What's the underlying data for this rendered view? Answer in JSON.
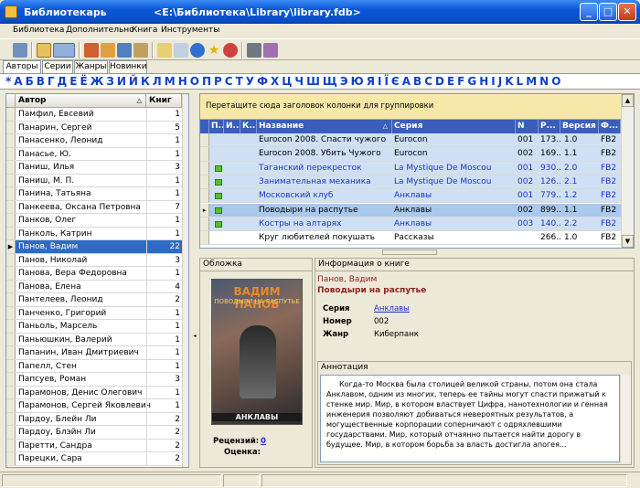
{
  "window": {
    "app_title": "Библиотекарь",
    "path": "<E:\\Библиотека\\Library\\library.fdb>"
  },
  "menu": [
    "Библиотека",
    "Дополнительно",
    "Книга",
    "Инструменты"
  ],
  "tabs": [
    "Авторы",
    "Серии",
    "Жанры",
    "Новинки"
  ],
  "alphabet": [
    "*",
    "А",
    "Б",
    "В",
    "Г",
    "Д",
    "Е",
    "Ё",
    "Ж",
    "З",
    "И",
    "Й",
    "К",
    "Л",
    "М",
    "Н",
    "О",
    "П",
    "Р",
    "С",
    "Т",
    "У",
    "Ф",
    "Х",
    "Ц",
    "Ч",
    "Ш",
    "Щ",
    "Э",
    "Ю",
    "Я",
    "І",
    "Ї",
    "Є",
    "A",
    "B",
    "C",
    "D",
    "E",
    "F",
    "G",
    "H",
    "I",
    "J",
    "K",
    "L",
    "M",
    "N",
    "O"
  ],
  "authors": {
    "headers": {
      "author": "Автор",
      "count": "Книг"
    },
    "rows": [
      {
        "name": "Памфил, Евсевий",
        "count": "1"
      },
      {
        "name": "Панарин, Сергей",
        "count": "5"
      },
      {
        "name": "Панасенко, Леонид",
        "count": "1"
      },
      {
        "name": "Панасье, Ю.",
        "count": "1"
      },
      {
        "name": "Паниш, Илья",
        "count": "3"
      },
      {
        "name": "Паниш, М. П.",
        "count": "1"
      },
      {
        "name": "Панина, Татьяна",
        "count": "1"
      },
      {
        "name": "Панкеева, Оксана Петровна",
        "count": "7"
      },
      {
        "name": "Панков, Олег",
        "count": "1"
      },
      {
        "name": "Панколь, Катрин",
        "count": "1"
      },
      {
        "name": "Панов, Вадим",
        "count": "22"
      },
      {
        "name": "Панов, Николай",
        "count": "3"
      },
      {
        "name": "Панова, Вера Федоровна",
        "count": "1"
      },
      {
        "name": "Панова, Елена",
        "count": "4"
      },
      {
        "name": "Пантелеев, Леонид",
        "count": "2"
      },
      {
        "name": "Панченко, Григорий",
        "count": "1"
      },
      {
        "name": "Паньоль, Марсель",
        "count": "1"
      },
      {
        "name": "Паньюшкин, Валерий",
        "count": "1"
      },
      {
        "name": "Папанин, Иван Дмитриевич",
        "count": "1"
      },
      {
        "name": "Папелл, Стен",
        "count": "1"
      },
      {
        "name": "Папсуев, Роман",
        "count": "3"
      },
      {
        "name": "Парамонов, Денис Олегович",
        "count": "1"
      },
      {
        "name": "Парамонов, Сергей Яковлевич",
        "count": "1"
      },
      {
        "name": "Пардоу, Блейн Ли",
        "count": "2"
      },
      {
        "name": "Пардоу, Блэйн Ли",
        "count": "2"
      },
      {
        "name": "Паретти, Сандра",
        "count": "2"
      },
      {
        "name": "Парецки, Сара",
        "count": "2"
      }
    ]
  },
  "books": {
    "group_hint": "Перетащите сюда заголовок колонки для группировки",
    "headers": {
      "p": "П..",
      "i": "И..",
      "k": "К..",
      "title": "Название",
      "series": "Серия",
      "n": "N",
      "r": "Р...",
      "version": "Версия",
      "format": "Ф..."
    },
    "rows": [
      {
        "title": "Eurocon 2008. Спасти чужого",
        "series": "Eurocon",
        "n": "001",
        "r": "173...",
        "version": "1.0",
        "format": "FB2",
        "blue": false,
        "icon": false
      },
      {
        "title": "Eurocon 2008. Убить Чужого",
        "series": "Eurocon",
        "n": "002",
        "r": "169...",
        "version": "1.1",
        "format": "FB2",
        "blue": false,
        "icon": false
      },
      {
        "title": "Таганский перекресток",
        "series": "La Mystique De Moscou",
        "n": "001",
        "r": "930...",
        "version": "2.0",
        "format": "FB2",
        "blue": true,
        "icon": true
      },
      {
        "title": "Занимательная механика",
        "series": "La Mystique De Moscou",
        "n": "002",
        "r": "126...",
        "version": "2.1",
        "format": "FB2",
        "blue": true,
        "icon": true
      },
      {
        "title": "Московский клуб",
        "series": "Анклавы",
        "n": "001",
        "r": "779...",
        "version": "1.2",
        "format": "FB2",
        "blue": true,
        "icon": true
      },
      {
        "title": "Поводыри на распутье",
        "series": "Анклавы",
        "n": "002",
        "r": "899...",
        "version": "1.1",
        "format": "FB2",
        "blue": false,
        "icon": true
      },
      {
        "title": "Костры на алтарях",
        "series": "Анклавы",
        "n": "003",
        "r": "140...",
        "version": "2.2",
        "format": "FB2",
        "blue": true,
        "icon": true
      },
      {
        "title": "Круг любителей покушать",
        "series": "Рассказы",
        "n": "",
        "r": "266...",
        "version": "1.0",
        "format": "FB2",
        "blue": false,
        "icon": false
      }
    ]
  },
  "cover_panel": {
    "title": "Обложка",
    "cover_author": "ВАДИМ ПАНОВ",
    "cover_title": "ПОВОДЫРИ НА РАСПУТЬЕ",
    "cover_series": "АНКЛАВЫ",
    "reviews_label": "Рецензий:",
    "reviews_value": "0",
    "rating_label": "Оценка:"
  },
  "info_panel": {
    "title": "Информация о книге",
    "author": "Панов, Вадим",
    "book_title": "Поводыри на распутье",
    "series_label": "Серия",
    "series_value": "Анклавы",
    "number_label": "Номер",
    "number_value": "002",
    "genre_label": "Жанр",
    "genre_value": "Киберпанк",
    "annotation_label": "Аннотация",
    "annotation": "Когда-то Москва была столицей великой страны, потом она стала Анклавом, одним из многих, теперь ее тайны могут спасти прижатый к стенке мир. Мир, в котором властвует Цифра, нанотехнологии и генная инженерия позволяют добиваться невероятных результатов, а могущественные корпорации соперничают с одряхлевшими государствами. Мир, который отчаянно пытается найти дорогу в будущее. Мир, в котором борьба за власть достигла апогея..."
  }
}
